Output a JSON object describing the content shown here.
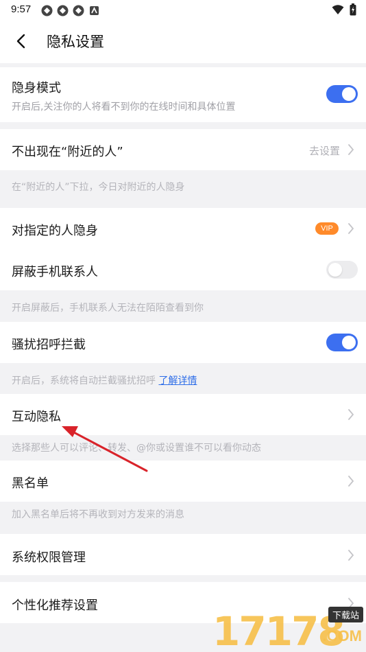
{
  "status_bar": {
    "time": "9:57"
  },
  "header": {
    "title": "隐私设置"
  },
  "settings": {
    "invisible_mode": {
      "label": "隐身模式",
      "desc": "开启后,关注你的人将看不到你的在线时间和具体位置",
      "enabled": true
    },
    "nearby": {
      "label": "不出现在“附近的人”",
      "action": "去设置",
      "note": "在“附近的人”下拉，今日对附近的人隐身"
    },
    "hide_from_specific": {
      "label": "对指定的人隐身",
      "badge": "VIP"
    },
    "block_contacts": {
      "label": "屏蔽手机联系人",
      "enabled": false,
      "note": "开启屏蔽后，手机联系人无法在陌陌查看到你"
    },
    "harassment_block": {
      "label": "骚扰招呼拦截",
      "enabled": true,
      "note": "开启后，系统将自动拦截骚扰招呼",
      "link": "了解详情"
    },
    "interaction_privacy": {
      "label": "互动隐私",
      "note": "选择那些人可以评论、转发、@你或设置谁不可以看你动态"
    },
    "blacklist": {
      "label": "黑名单",
      "note": "加入黑名单后将不再收到对方发来的消息"
    },
    "system_permissions": {
      "label": "系统权限管理"
    },
    "personalization": {
      "label": "个性化推荐设置"
    }
  },
  "watermark": {
    "digits": "17178",
    "download": "下载站",
    "domain": ".COM"
  },
  "colors": {
    "accent": "#3c6ff0",
    "vip": "#ff8a2a",
    "annotation_arrow": "#d9232a"
  }
}
